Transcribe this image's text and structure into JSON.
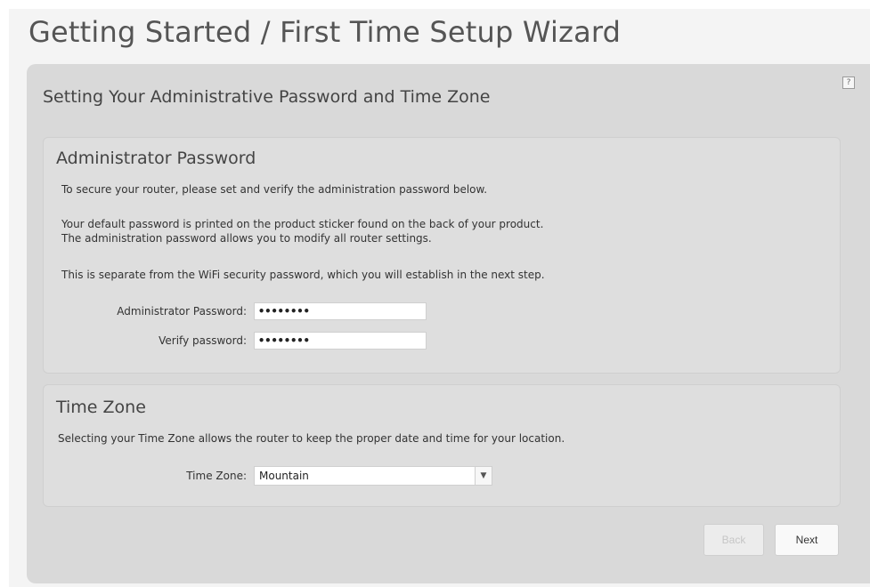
{
  "header": {
    "title": "Getting Started / First Time Setup Wizard"
  },
  "panel": {
    "title": "Setting Your Administrative Password and Time Zone",
    "help_label": "?"
  },
  "admin_section": {
    "heading": "Administrator Password",
    "line1": "To secure your router, please set and verify the administration password below.",
    "line2": "Your default password is printed on the product sticker found on the back of your product.",
    "line3": "The administration password allows you to modify all router settings.",
    "line4": "This is separate from the WiFi security password, which you will establish in the next step.",
    "password_label": "Administrator Password:",
    "password_value": "••••••••",
    "verify_label": "Verify password:",
    "verify_value": "••••••••"
  },
  "timezone_section": {
    "heading": "Time Zone",
    "description": "Selecting your Time Zone allows the router to keep the proper date and time for your location.",
    "label": "Time Zone:",
    "selected": "Mountain",
    "arrow_icon": "chevron-down-icon"
  },
  "buttons": {
    "back": "Back",
    "next": "Next",
    "back_state": "disabled"
  },
  "colors": {
    "panel_bg": "#d9d9d9",
    "section_bg": "#dedede",
    "title_text": "#555555"
  }
}
